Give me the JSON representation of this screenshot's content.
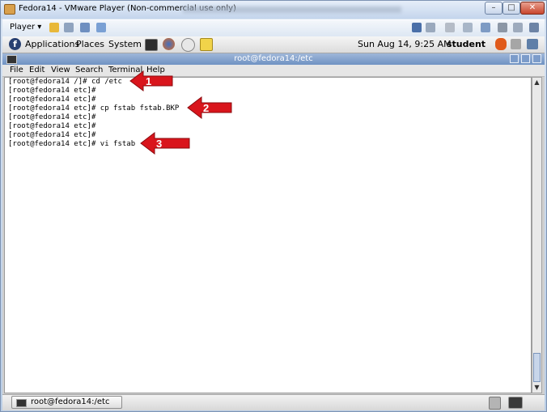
{
  "vmware": {
    "window_title": "Fedora14 - VMware Player (Non-commercial use only)",
    "min_label": "–",
    "max_label": "□",
    "close_label": "✕",
    "player_menu": "Player ▾"
  },
  "guest_panel": {
    "menus": [
      "Applications",
      "Places",
      "System"
    ],
    "clock": "Sun Aug 14,  9:25 AM",
    "user": "student"
  },
  "terminal": {
    "title": "root@fedora14:/etc",
    "menus": [
      "File",
      "Edit",
      "View",
      "Search",
      "Terminal",
      "Help"
    ],
    "lines": [
      "[root@fedora14 /]# cd /etc",
      "[root@fedora14 etc]#",
      "[root@fedora14 etc]#",
      "[root@fedora14 etc]# cp fstab fstab.BKP",
      "[root@fedora14 etc]#",
      "[root@fedora14 etc]#",
      "[root@fedora14 etc]#",
      "[root@fedora14 etc]# vi fstab"
    ]
  },
  "taskbar": {
    "window_button": "root@fedora14:/etc"
  },
  "annotations": [
    {
      "number": "1",
      "color": "#d9151c"
    },
    {
      "number": "2",
      "color": "#d9151c"
    },
    {
      "number": "3",
      "color": "#d9151c"
    }
  ]
}
